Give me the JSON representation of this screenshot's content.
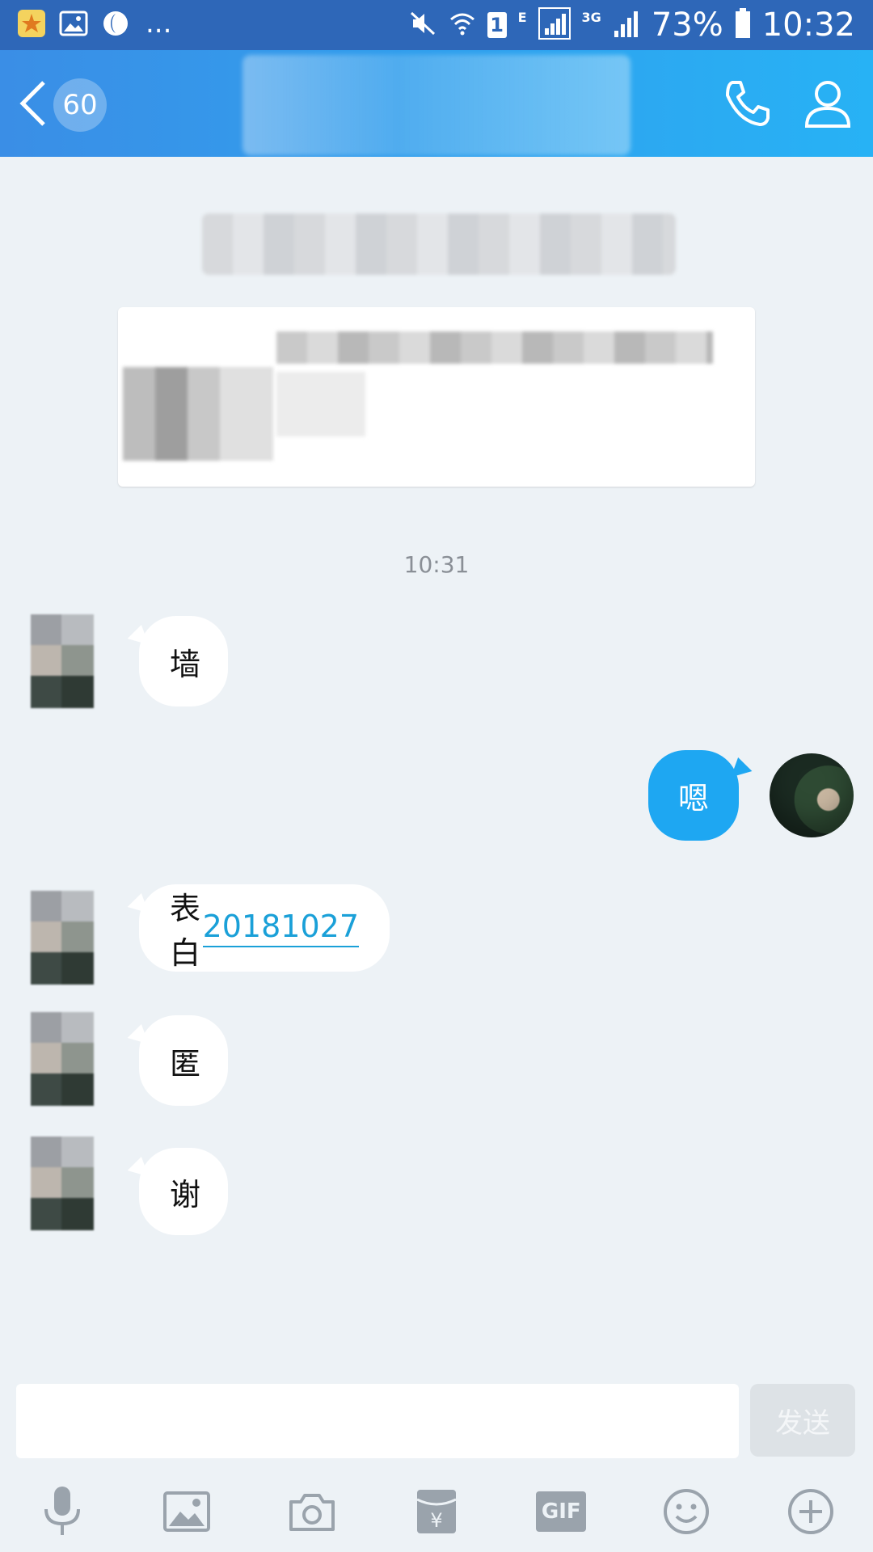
{
  "status_bar": {
    "network_small": "E",
    "network_3g": "3G",
    "sim_badge": "1",
    "battery": "73%",
    "time": "10:32",
    "dots": "..."
  },
  "header": {
    "back_badge": "60"
  },
  "chat": {
    "timestamp": "10:31",
    "messages": [
      {
        "side": "in",
        "text": "墙"
      },
      {
        "side": "out",
        "text": "嗯"
      },
      {
        "side": "in",
        "text_prefix": "表白",
        "link": "20181027"
      },
      {
        "side": "in",
        "text": "匿"
      },
      {
        "side": "in",
        "text": "谢"
      }
    ]
  },
  "input": {
    "value": "",
    "send_label": "发送"
  },
  "toolbar": {
    "gif_label": "GIF",
    "yen_label": "¥"
  },
  "colors": {
    "header_start": "#3A8EE6",
    "header_end": "#27B2F5",
    "outgoing_bubble": "#1EA7F2",
    "link": "#1AA0D8",
    "chat_bg": "#EDF2F6"
  }
}
